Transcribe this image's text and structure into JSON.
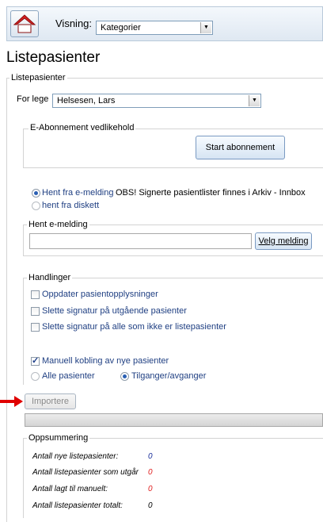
{
  "toolbar": {
    "visning_label": "Visning:",
    "visning_value": "Kategorier"
  },
  "page_title": "Listepasienter",
  "listepasienter_group": {
    "legend": "Listepasienter",
    "lege_label": "For lege",
    "lege_value": "Helsesen, Lars"
  },
  "abonnement": {
    "legend": "E-Abonnement vedlikehold",
    "start_button": "Start abonnement"
  },
  "source": {
    "option_email": "Hent fra e-melding",
    "obs_text": "OBS! Signerte pasientlister finnes i Arkiv - Innbox",
    "option_disk": "hent fra diskett"
  },
  "hent": {
    "legend": "Hent e-melding",
    "input_value": "",
    "velg_button": "Velg melding"
  },
  "handlinger": {
    "legend": "Handlinger",
    "cb1": "Oppdater pasientopplysninger",
    "cb2": "Slette signatur på utgående pasienter",
    "cb3": "Slette signatur på alle som ikke er listepasienter",
    "cb4": "Manuell kobling av nye pasienter",
    "radio_alle": "Alle pasienter",
    "radio_tilganger": "Tilganger/avganger"
  },
  "importere_button": "Importere",
  "progress": 0,
  "oppsummering": {
    "legend": "Oppsummering",
    "rows": [
      {
        "label": "Antall nye listepasienter:",
        "value": "0",
        "color": "#1a2f9a"
      },
      {
        "label": "Antall listepasienter som utgår",
        "value": "0",
        "color": "#e02020"
      },
      {
        "label": "Antall lagt til manuelt:",
        "value": "0",
        "color": "#e02020"
      },
      {
        "label": "Antall listepasienter totalt:",
        "value": "0",
        "color": "#000000"
      }
    ]
  },
  "colors": {
    "accent_red": "#e02020",
    "arrow": "#e00000"
  }
}
